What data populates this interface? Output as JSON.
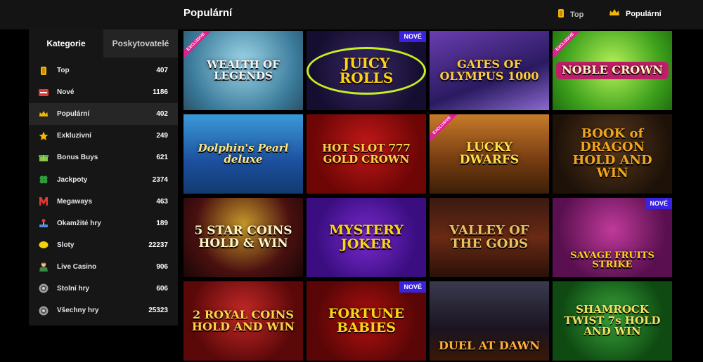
{
  "header": {
    "title": "Populární",
    "tabs": [
      {
        "label": "Top",
        "icon": "gold-bar-icon"
      },
      {
        "label": "Populární",
        "icon": "crown-icon"
      }
    ]
  },
  "sidebar": {
    "tabs": [
      "Kategorie",
      "Poskytovatelé"
    ],
    "items": [
      {
        "label": "Top",
        "count": "407",
        "icon": "gold-bar-icon"
      },
      {
        "label": "Nové",
        "count": "1186",
        "icon": "new-icon"
      },
      {
        "label": "Populární",
        "count": "402",
        "icon": "crown-icon"
      },
      {
        "label": "Exkluzivní",
        "count": "249",
        "icon": "star-icon"
      },
      {
        "label": "Bonus Buys",
        "count": "621",
        "icon": "bonus-icon"
      },
      {
        "label": "Jackpoty",
        "count": "2374",
        "icon": "clover-icon"
      },
      {
        "label": "Megaways",
        "count": "463",
        "icon": "megaways-icon"
      },
      {
        "label": "Okamžité hry",
        "count": "189",
        "icon": "joystick-icon"
      },
      {
        "label": "Sloty",
        "count": "22237",
        "icon": "lemon-icon"
      },
      {
        "label": "Live Casino",
        "count": "906",
        "icon": "dealer-icon"
      },
      {
        "label": "Stolní hry",
        "count": "606",
        "icon": "chip-icon"
      },
      {
        "label": "Všechny hry",
        "count": "25323",
        "icon": "chip-icon"
      }
    ]
  },
  "badges": {
    "new": "NOVÉ",
    "exclusive": "EXCLUSIVE"
  },
  "games": [
    {
      "title": "WEALTH OF LEGENDS"
    },
    {
      "title": "JUICY ROLLS"
    },
    {
      "title": "GATES OF OLYMPUS 1000"
    },
    {
      "title": "NOBLE CROWN"
    },
    {
      "title": "Dolphin's Pearl deluxe"
    },
    {
      "title": "HOT SLOT 777 GOLD CROWN"
    },
    {
      "title": "LUCKY DWARFS"
    },
    {
      "title": "BOOK of DRAGON HOLD AND WIN"
    },
    {
      "title": "5 STAR COINS HOLD & WIN"
    },
    {
      "title": "MYSTERY JOKER"
    },
    {
      "title": "VALLEY OF THE GODS"
    },
    {
      "title": "SAVAGE FRUITS STRIKE"
    },
    {
      "title": "2 ROYAL COINS HOLD AND WIN"
    },
    {
      "title": "FORTUNE BABIES"
    },
    {
      "title": "DUEL AT DAWN"
    },
    {
      "title": "SHAMROCK TWIST 7s HOLD AND WIN"
    }
  ],
  "colors": {
    "accent": "#3b22e0",
    "ribbon": "#e0208f",
    "gold": "#f2b705"
  }
}
